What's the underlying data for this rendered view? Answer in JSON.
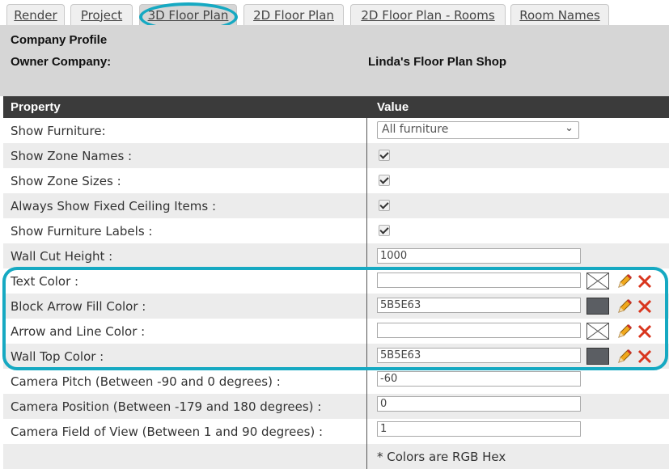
{
  "tabs": [
    {
      "label": "Render",
      "active": false
    },
    {
      "label": "Project",
      "active": false
    },
    {
      "label": "3D Floor Plan",
      "active": true
    },
    {
      "label": "2D Floor Plan",
      "active": false
    },
    {
      "label": "2D Floor Plan - Rooms",
      "active": false
    },
    {
      "label": "Room Names",
      "active": false
    }
  ],
  "header": {
    "title": "Company Profile",
    "owner_label": "Owner Company:",
    "owner_value": "Linda's Floor Plan Shop"
  },
  "table": {
    "col_property": "Property",
    "col_value": "Value"
  },
  "rows": {
    "show_furniture": {
      "label": "Show Furniture:",
      "value": "All furniture"
    },
    "show_zone_names": {
      "label": "Show Zone Names :",
      "checked": true
    },
    "show_zone_sizes": {
      "label": "Show Zone Sizes :",
      "checked": true
    },
    "always_show_ceiling": {
      "label": "Always Show Fixed Ceiling Items :",
      "checked": true
    },
    "show_furniture_labels": {
      "label": "Show Furniture Labels :",
      "checked": true
    },
    "wall_cut_height": {
      "label": "Wall Cut Height :",
      "value": "1000"
    },
    "text_color": {
      "label": "Text Color :",
      "value": ""
    },
    "block_arrow_fill_color": {
      "label": "Block Arrow Fill Color :",
      "value": "5B5E63",
      "swatch": "#5b5e63"
    },
    "arrow_line_color": {
      "label": "Arrow and Line Color :",
      "value": ""
    },
    "wall_top_color": {
      "label": "Wall Top Color :",
      "value": "5B5E63",
      "swatch": "#5b5e63"
    },
    "camera_pitch": {
      "label": "Camera Pitch (Between -90 and 0 degrees) :",
      "value": "-60"
    },
    "camera_position": {
      "label": "Camera Position (Between -179 and 180 degrees) :",
      "value": "0"
    },
    "camera_fov": {
      "label": "Camera Field of View (Between 1 and 90 degrees) :",
      "value": "1"
    }
  },
  "footnote": "* Colors are RGB Hex",
  "colors": {
    "highlight": "#16a9c2",
    "table_header_bg": "#3b3b3b",
    "header_bg": "#d6d6d6",
    "pencil": "#f0a81c",
    "delete": "#d9361e"
  }
}
